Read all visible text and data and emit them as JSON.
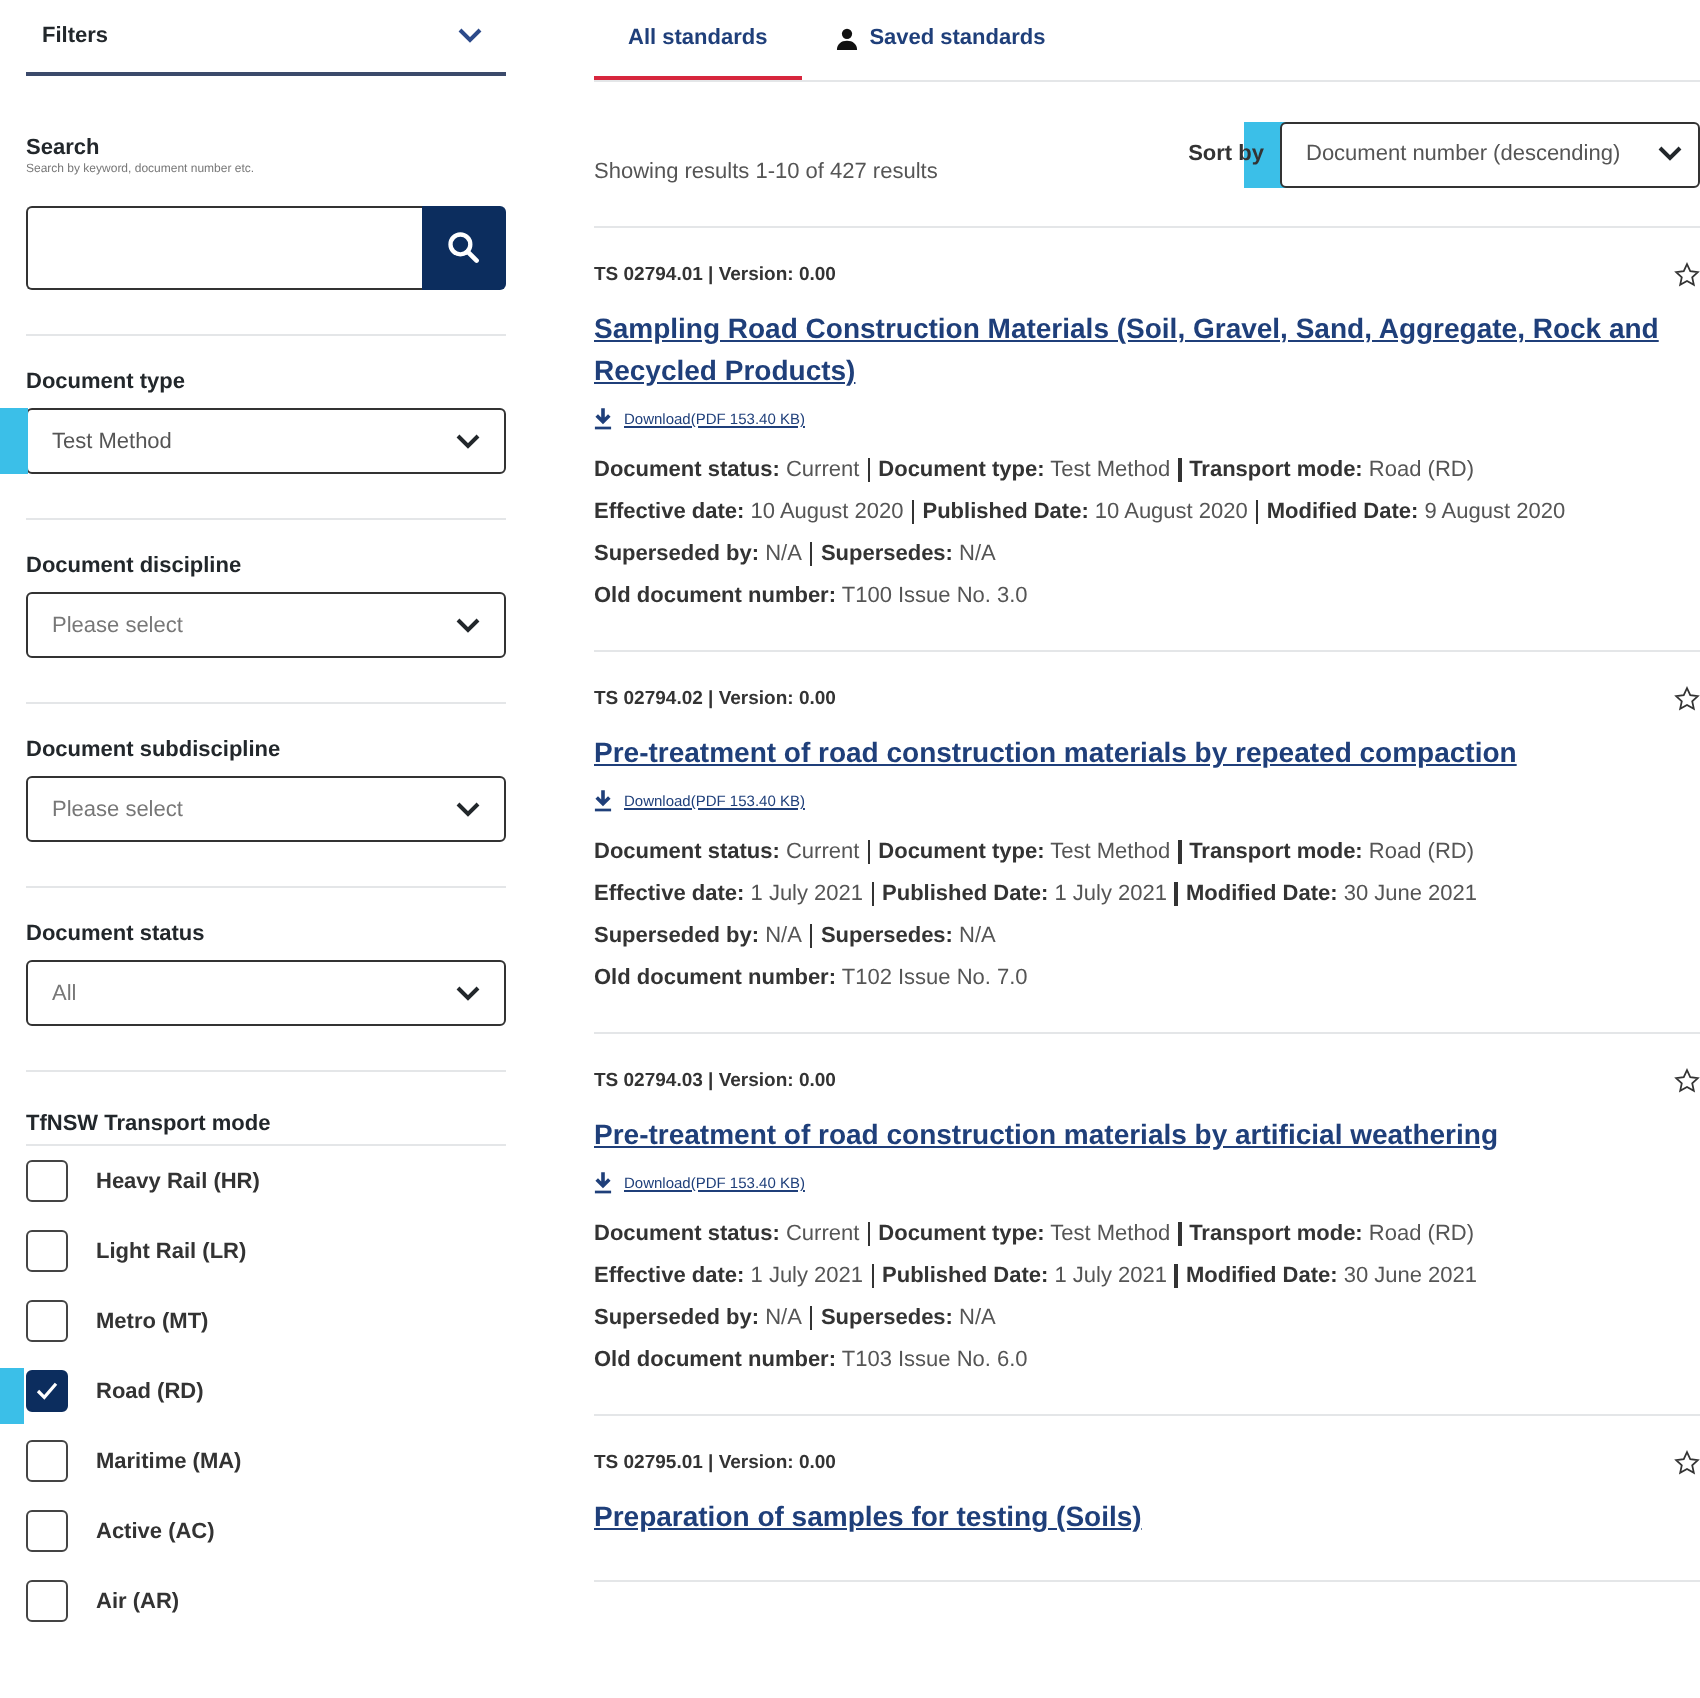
{
  "filters": {
    "title": "Filters",
    "expanded": true
  },
  "search": {
    "label": "Search",
    "hint": "Search by keyword, document number etc."
  },
  "selects": [
    {
      "label": "Document type",
      "value": "Test Method",
      "placeholder_shown": false,
      "highlighted": true
    },
    {
      "label": "Document discipline",
      "value": "Please select",
      "placeholder_shown": true,
      "highlighted": false
    },
    {
      "label": "Document subdiscipline",
      "value": "Please select",
      "placeholder_shown": true,
      "highlighted": false
    },
    {
      "label": "Document status",
      "value": "All",
      "placeholder_shown": true,
      "highlighted": false
    }
  ],
  "transport_mode": {
    "label": "TfNSW Transport mode",
    "options": [
      {
        "label": "Heavy Rail (HR)",
        "checked": false,
        "highlighted": false
      },
      {
        "label": "Light Rail (LR)",
        "checked": false,
        "highlighted": false
      },
      {
        "label": "Metro (MT)",
        "checked": false,
        "highlighted": false
      },
      {
        "label": "Road (RD)",
        "checked": true,
        "highlighted": true
      },
      {
        "label": "Maritime (MA)",
        "checked": false,
        "highlighted": false
      },
      {
        "label": "Active (AC)",
        "checked": false,
        "highlighted": false
      },
      {
        "label": "Air (AR)",
        "checked": false,
        "highlighted": false
      }
    ]
  },
  "tabs": [
    {
      "label": "All standards",
      "selected": true,
      "kind": "plain"
    },
    {
      "label": "Saved standards",
      "selected": false,
      "kind": "person"
    }
  ],
  "results_count": "Showing results 1-10 of 427 results",
  "sort": {
    "label": "Sort by",
    "value": "Document number (descending)",
    "highlighted": true
  },
  "results": [
    {
      "meta": "TS 02794.01 | Version: 0.00",
      "title": "Sampling Road Construction Materials (Soil, Gravel, Sand, Aggregate, Rock and Recycled Products)",
      "download": "Download(PDF 153.40 KB)",
      "details": [
        [
          {
            "label": "Document status:",
            "value": "Current"
          },
          {
            "label": "Document type:",
            "value": "Test Method"
          },
          {
            "label": "Transport mode:",
            "value": "Road (RD)"
          }
        ],
        [
          {
            "label": "Effective date:",
            "value": "10 August 2020"
          },
          {
            "label": "Published Date:",
            "value": "10 August 2020"
          },
          {
            "label": "Modified Date:",
            "value": "9 August 2020"
          }
        ],
        [
          {
            "label": "Superseded by:",
            "value": "N/A"
          },
          {
            "label": "Supersedes:",
            "value": "N/A"
          }
        ],
        [
          {
            "label": "Old document number:",
            "value": "T100 Issue No. 3.0"
          }
        ]
      ]
    },
    {
      "meta": "TS 02794.02 | Version: 0.00",
      "title": "Pre-treatment of road construction materials by repeated compaction",
      "download": "Download(PDF 153.40 KB)",
      "details": [
        [
          {
            "label": "Document status:",
            "value": "Current"
          },
          {
            "label": "Document type:",
            "value": "Test Method"
          },
          {
            "label": "Transport mode:",
            "value": "Road (RD)"
          }
        ],
        [
          {
            "label": "Effective date:",
            "value": "1 July 2021"
          },
          {
            "label": "Published Date:",
            "value": "1 July 2021"
          },
          {
            "label": "Modified Date:",
            "value": "30 June 2021"
          }
        ],
        [
          {
            "label": "Superseded by:",
            "value": "N/A"
          },
          {
            "label": "Supersedes:",
            "value": "N/A"
          }
        ],
        [
          {
            "label": "Old document number:",
            "value": "T102 Issue No. 7.0"
          }
        ]
      ]
    },
    {
      "meta": "TS 02794.03 | Version: 0.00",
      "title": "Pre-treatment of road construction materials by artificial weathering",
      "download": "Download(PDF 153.40 KB)",
      "details": [
        [
          {
            "label": "Document status:",
            "value": "Current"
          },
          {
            "label": "Document type:",
            "value": "Test Method"
          },
          {
            "label": "Transport mode:",
            "value": "Road (RD)"
          }
        ],
        [
          {
            "label": "Effective date:",
            "value": "1 July 2021"
          },
          {
            "label": "Published Date:",
            "value": "1 July 2021"
          },
          {
            "label": "Modified Date:",
            "value": "30 June 2021"
          }
        ],
        [
          {
            "label": "Superseded by:",
            "value": "N/A"
          },
          {
            "label": "Supersedes:",
            "value": "N/A"
          }
        ],
        [
          {
            "label": "Old document number:",
            "value": "T103 Issue No. 6.0"
          }
        ]
      ]
    },
    {
      "meta": "TS 02795.01 | Version: 0.00",
      "title": "Preparation of samples for testing (Soils)"
    }
  ]
}
